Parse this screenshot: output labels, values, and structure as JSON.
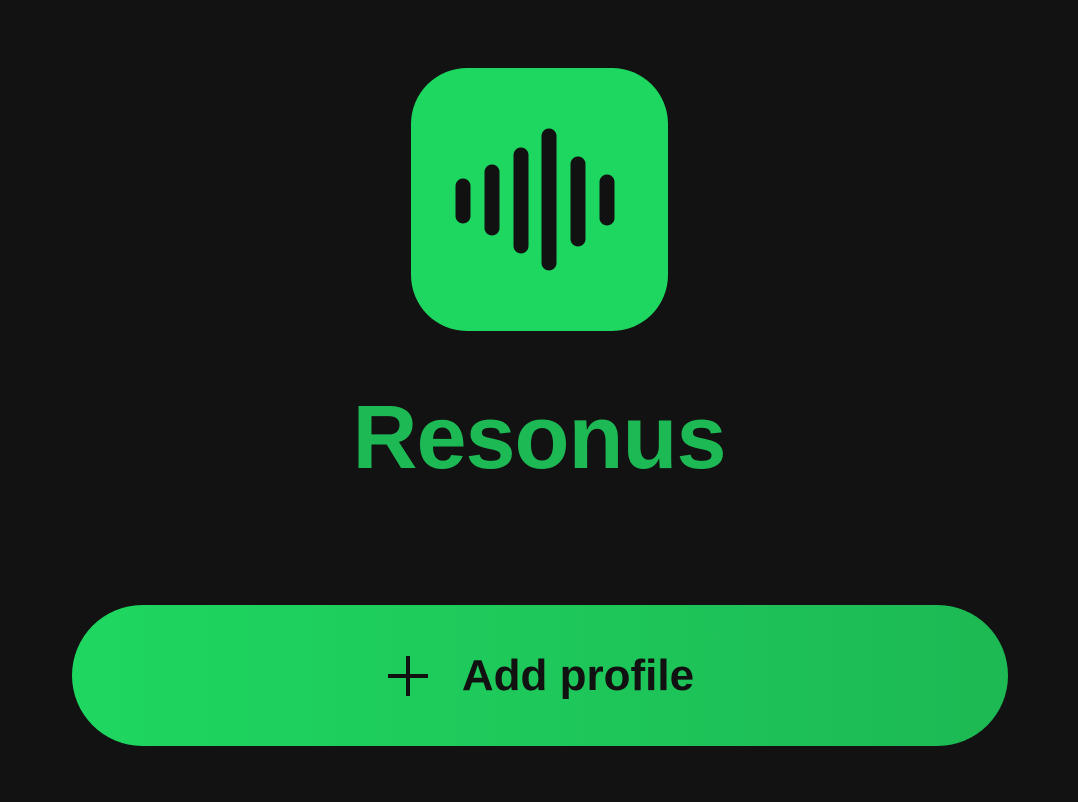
{
  "app": {
    "name": "Resonus",
    "icon": "sound-wave-icon"
  },
  "actions": {
    "add_profile_label": "Add profile",
    "add_profile_icon": "plus-icon"
  },
  "colors": {
    "background": "#121212",
    "accent": "#1ed760",
    "accent_dark": "#1db954",
    "icon_foreground": "#111111"
  }
}
